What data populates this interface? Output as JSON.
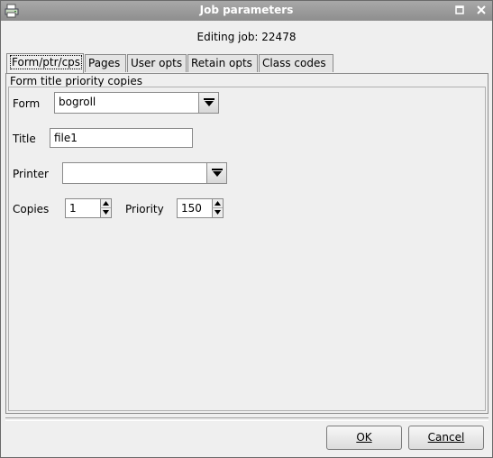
{
  "window": {
    "title": "Job parameters",
    "editing_label": "Editing job: 22478"
  },
  "tabs": [
    {
      "label": "Form/ptr/cps",
      "active": true
    },
    {
      "label": "Pages",
      "active": false
    },
    {
      "label": "User opts",
      "active": false
    },
    {
      "label": "Retain opts",
      "active": false
    },
    {
      "label": "Class codes",
      "active": false
    }
  ],
  "panel": {
    "group_title": "Form title priority copies",
    "form": {
      "label": "Form",
      "value": "bogroll"
    },
    "title": {
      "label": "Title",
      "value": "file1"
    },
    "printer": {
      "label": "Printer",
      "value": ""
    },
    "copies": {
      "label": "Copies",
      "value": "1"
    },
    "priority": {
      "label": "Priority",
      "value": "150"
    }
  },
  "buttons": {
    "ok": "OK",
    "cancel": "Cancel"
  },
  "icons": {
    "app": "printer-app-icon",
    "maximize": "maximize-icon",
    "close": "close-icon",
    "dropdown": "chevron-down-icon",
    "spin_up": "arrow-up-icon",
    "spin_down": "arrow-down-icon"
  }
}
